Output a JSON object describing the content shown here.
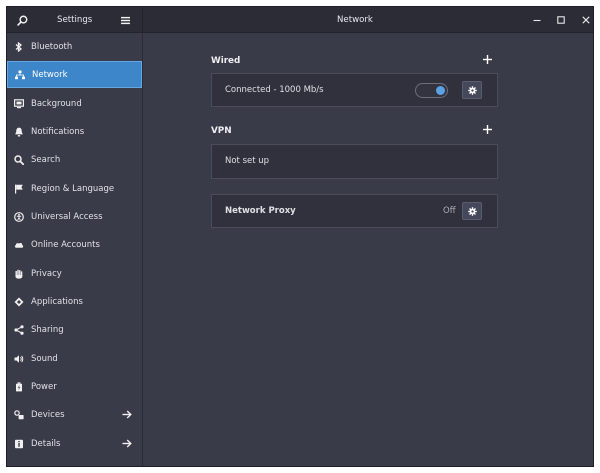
{
  "header": {
    "settings_title": "Settings",
    "panel_title": "Network"
  },
  "sidebar": {
    "items": [
      {
        "label": "Bluetooth",
        "icon": "bluetooth-icon"
      },
      {
        "label": "Network",
        "icon": "network-icon",
        "active": true
      },
      {
        "label": "Background",
        "icon": "background-icon"
      },
      {
        "label": "Notifications",
        "icon": "bell-icon"
      },
      {
        "label": "Search",
        "icon": "search-icon"
      },
      {
        "label": "Region & Language",
        "icon": "flag-icon"
      },
      {
        "label": "Universal Access",
        "icon": "accessibility-icon"
      },
      {
        "label": "Online Accounts",
        "icon": "cloud-icon"
      },
      {
        "label": "Privacy",
        "icon": "hand-icon"
      },
      {
        "label": "Applications",
        "icon": "applications-icon"
      },
      {
        "label": "Sharing",
        "icon": "share-icon"
      },
      {
        "label": "Sound",
        "icon": "speaker-icon"
      },
      {
        "label": "Power",
        "icon": "power-icon"
      },
      {
        "label": "Devices",
        "icon": "devices-icon",
        "arrow": true
      },
      {
        "label": "Details",
        "icon": "info-icon",
        "arrow": true
      }
    ]
  },
  "wired": {
    "title": "Wired",
    "status": "Connected - 1000 Mb/s",
    "enabled": true
  },
  "vpn": {
    "title": "VPN",
    "status": "Not set up"
  },
  "proxy": {
    "label": "Network Proxy",
    "value": "Off"
  },
  "colors": {
    "accent": "#3c86c9",
    "background": "#393b48",
    "card": "#30313c",
    "header": "#2b2c36"
  }
}
